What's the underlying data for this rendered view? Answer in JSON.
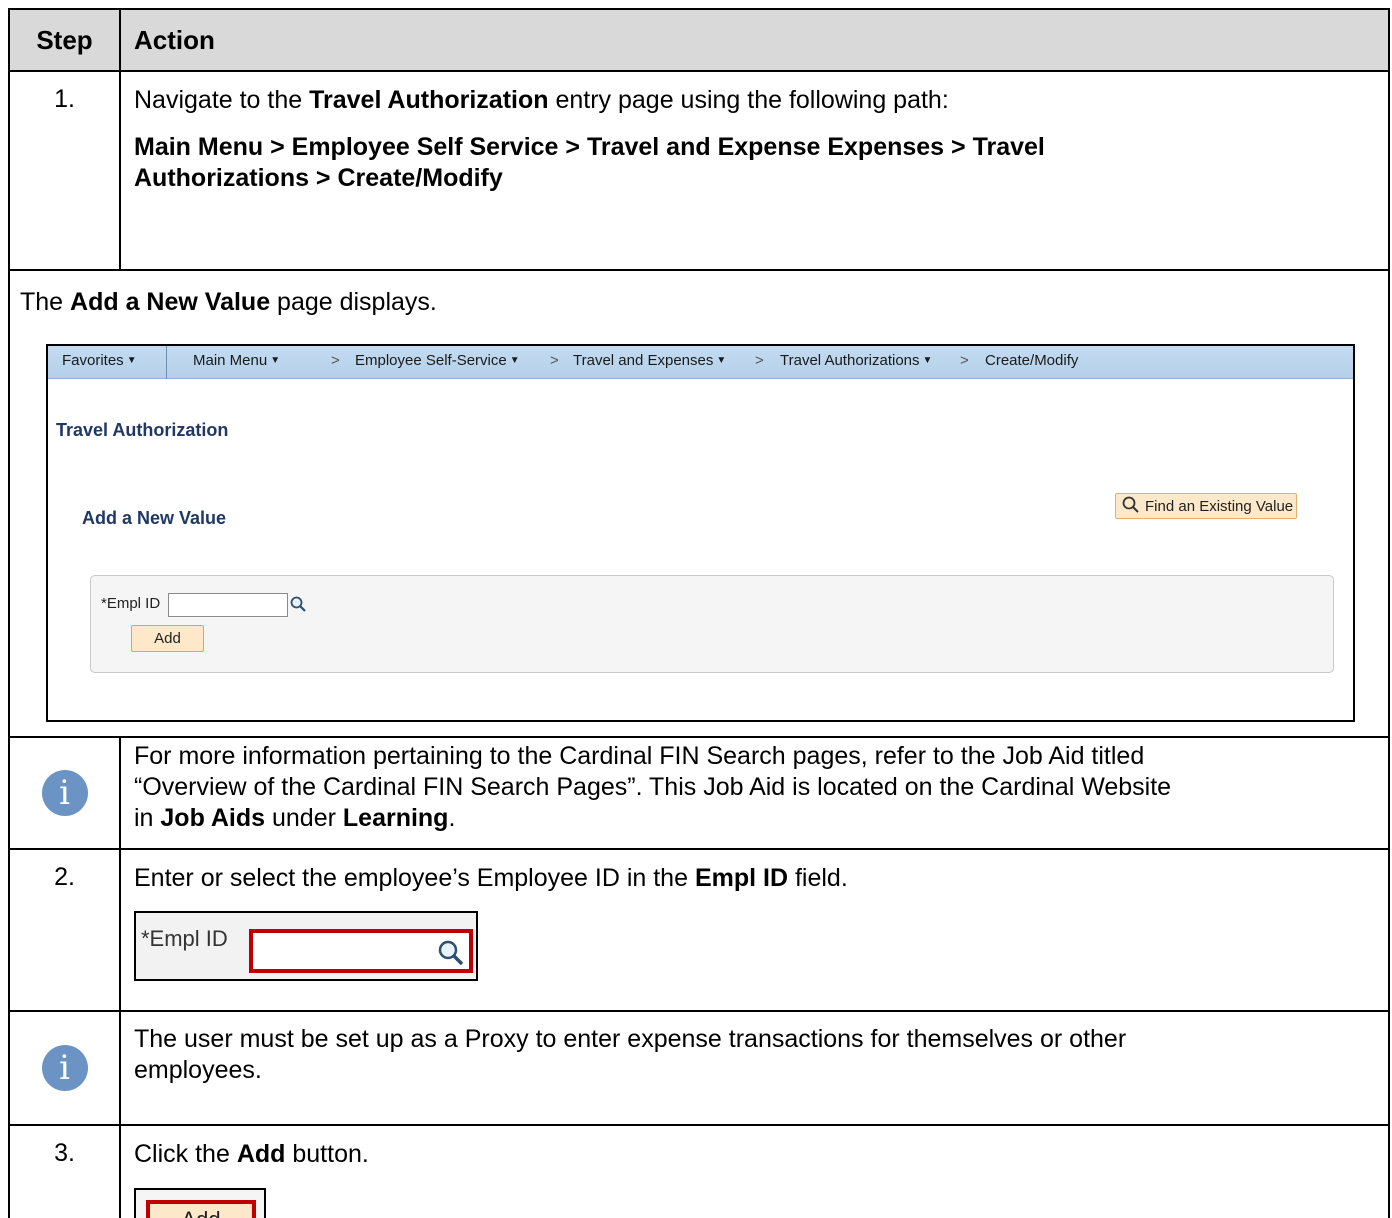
{
  "header": {
    "step": "Step",
    "action": "Action"
  },
  "step1": {
    "number": "1.",
    "text_pre": "Navigate to the ",
    "text_bold": "Travel Authorization",
    "text_post": " entry page using the following path:",
    "path_line1": "Main Menu > Employee Self Service > Travel and Expense Expenses > Travel",
    "path_line2": "Authorizations > Create/Modify"
  },
  "result1": {
    "pre": "The ",
    "bold": "Add a New Value",
    "post": " page displays."
  },
  "screenshot": {
    "nav": {
      "favorites": "Favorites",
      "main_menu": "Main Menu",
      "ess": "Employee Self-Service",
      "te": "Travel and Expenses",
      "ta": "Travel Authorizations",
      "cm": "Create/Modify",
      "chevron": ">"
    },
    "title": "Travel Authorization",
    "subtitle": "Add a New Value",
    "find_button": "Find an Existing Value",
    "empl_label": "*Empl ID",
    "empl_value": "",
    "add_button": "Add"
  },
  "info1": {
    "line1": "For more information pertaining to the Cardinal FIN Search pages, refer to the Job Aid titled",
    "line2": "“Overview of the Cardinal FIN Search Pages”.  This Job Aid is located on the Cardinal Website",
    "line3_pre": "in ",
    "line3_b1": "Job Aids",
    "line3_mid": " under ",
    "line3_b2": "Learning",
    "line3_post": "."
  },
  "step2": {
    "number": "2.",
    "pre": "Enter or select the employee’s Employee ID in the ",
    "bold": "Empl ID",
    "post": " field.",
    "shot_label": "*Empl ID"
  },
  "info2": {
    "line1": "The user must be set up as a Proxy to enter expense transactions for themselves or other",
    "line2": "employees."
  },
  "step3": {
    "number": "3.",
    "pre": "Click the ",
    "bold": "Add",
    "post": " button.",
    "shot_button": "Add"
  },
  "icons": {
    "info": "info-icon",
    "search": "magnifier-icon",
    "caret": "caret-down-icon"
  },
  "colors": {
    "highlight": "#c00000",
    "nav_bg": "#bdd7ee",
    "ps_title": "#1f3864",
    "info_icon": "#6b93c4",
    "button_bg": "#fde9c9"
  }
}
